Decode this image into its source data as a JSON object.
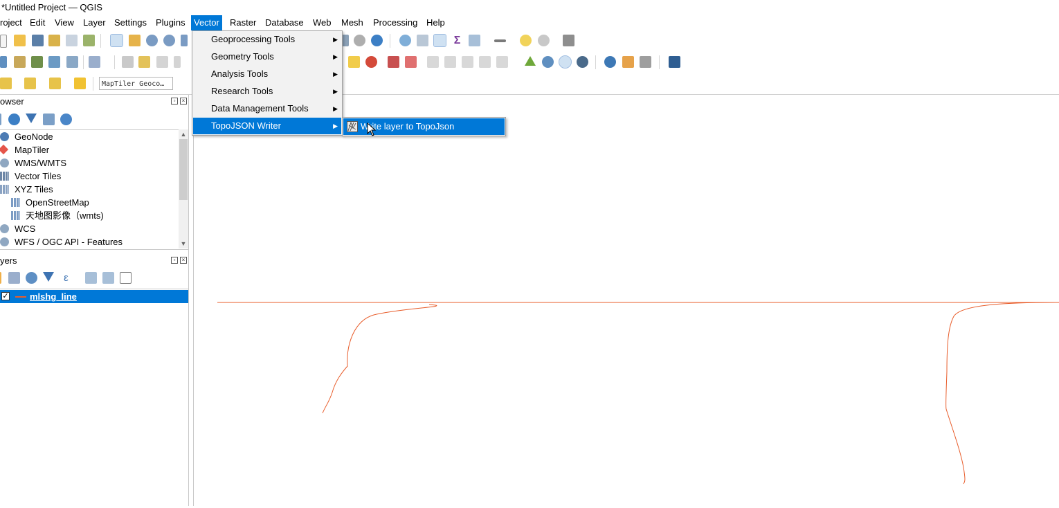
{
  "window": {
    "title": "*Untitled Project — QGIS"
  },
  "menubar": {
    "items": [
      "roject",
      "Edit",
      "View",
      "Layer",
      "Settings",
      "Plugins",
      "Vector",
      "Raster",
      "Database",
      "Web",
      "Mesh",
      "Processing",
      "Help"
    ],
    "active": "Vector"
  },
  "toolbar": {
    "locator_placeholder": "MapTiler Geoco…"
  },
  "browser_panel": {
    "title": "owser",
    "items": [
      {
        "label": "GeoNode",
        "icon": "geonode-icon"
      },
      {
        "label": "MapTiler",
        "icon": "maptiler-icon"
      },
      {
        "label": "WMS/WMTS",
        "icon": "globe-icon"
      },
      {
        "label": "Vector Tiles",
        "icon": "grid-icon"
      },
      {
        "label": "XYZ Tiles",
        "icon": "grid-icon"
      },
      {
        "label": "OpenStreetMap",
        "icon": "grid-icon"
      },
      {
        "label": "天地图影像（wmts)",
        "icon": "grid-icon"
      },
      {
        "label": "WCS",
        "icon": "globe-icon"
      },
      {
        "label": "WFS / OGC API - Features",
        "icon": "globe-icon"
      }
    ]
  },
  "layers_panel": {
    "title": "yers",
    "layers": [
      {
        "name": "mlshg_line",
        "checked": true,
        "symbol_color": "#e85c2a"
      }
    ]
  },
  "vector_menu": {
    "items": [
      {
        "label": "Geoprocessing Tools",
        "has_submenu": true
      },
      {
        "label": "Geometry Tools",
        "has_submenu": true
      },
      {
        "label": "Analysis Tools",
        "has_submenu": true
      },
      {
        "label": "Research Tools",
        "has_submenu": true
      },
      {
        "label": "Data Management Tools",
        "has_submenu": true
      },
      {
        "label": "TopoJSON Writer",
        "has_submenu": true,
        "highlighted": true
      }
    ]
  },
  "topojson_submenu": {
    "items": [
      {
        "label": "Write layer to TopoJson",
        "highlighted": true
      }
    ]
  },
  "colors": {
    "accent": "#0078d7",
    "line": "#e85c2a"
  }
}
